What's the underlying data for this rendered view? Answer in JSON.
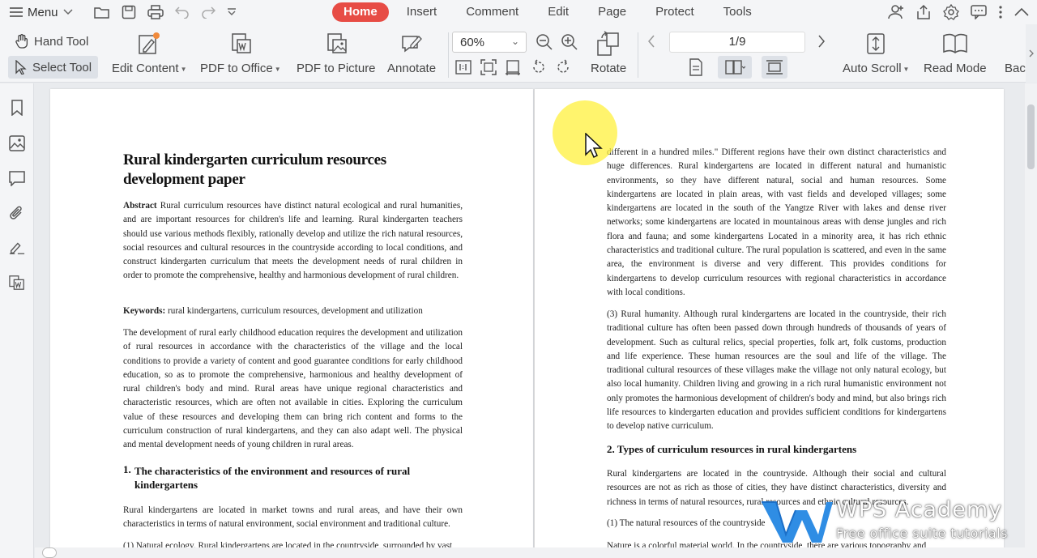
{
  "menubar": {
    "menu_label": "Menu",
    "tabs": [
      "Home",
      "Insert",
      "Comment",
      "Edit",
      "Page",
      "Protect",
      "Tools"
    ],
    "active_tab": "Home",
    "accent_color": "#e74c45"
  },
  "ribbon": {
    "hand_tool": "Hand Tool",
    "select_tool": "Select Tool",
    "edit_content": "Edit Content",
    "pdf_to_office": "PDF to Office",
    "pdf_to_picture": "PDF to Picture",
    "annotate": "Annotate",
    "zoom": "60%",
    "rotate": "Rotate",
    "page_indicator": "1/9",
    "auto_scroll": "Auto Scroll",
    "read_mode": "Read Mode",
    "back": "Bac"
  },
  "document": {
    "title_line1": "Rural kindergarten curriculum resources",
    "title_line2": "development paper",
    "abstract_label": "Abstract",
    "abstract_text": " Rural curriculum resources have distinct natural ecological and rural humanities, and are important resources for children's life and learning. Rural kindergarten teachers should use various methods flexibly, rationally develop and utilize the rich natural resources, social resources and cultural resources in the countryside according to local conditions, and construct kindergarten curriculum that meets the development needs of rural children in order to promote the comprehensive, healthy and harmonious development of rural children.",
    "keywords_label": "Keywords:",
    "keywords_text": " rural kindergartens, curriculum resources, development and utilization",
    "intro_text": "The development of rural early childhood education requires the development and utilization of rural resources in accordance with the characteristics of the village and the local conditions to provide a variety of content and good guarantee conditions for early childhood education, so as to promote the comprehensive, harmonious and healthy development of rural children's body and mind. Rural areas have unique regional characteristics and characteristic resources, which are often not available in cities. Exploring the curriculum value of these resources and developing them can bring rich content and forms to the curriculum construction of rural kindergartens, and they can also adapt well. The physical and mental development needs of young children in rural areas.",
    "section1_num": "1.",
    "section1_title_line1": "The characteristics of the environment and resources of rural",
    "section1_title_line2": "kindergartens",
    "section1_text": "Rural kindergartens are located in market towns and rural areas, and have their own characteristics in terms of natural environment, social environment and traditional culture.",
    "section1_sub": "(1) Natural ecology. Rural kindergartens are located in the countryside, surrounded by vast",
    "right_p1": "different in a hundred miles.\" Different regions have their own distinct characteristics and huge differences. Rural kindergartens are located in different natural and humanistic environments, so they have different natural, social and human resources. Some kindergartens are located in plain areas, with vast fields and developed villages; some kindergartens are located in the south of the Yangtze River with lakes and dense river networks; some kindergartens are located in mountainous areas with dense jungles and rich flora and fauna; and some kindergartens Located in a minority area, it has rich ethnic characteristics and traditional culture. The rural population is scattered, and even in the same area, the environment is diverse and very different. This provides conditions for kindergartens to develop curriculum resources with regional characteristics in accordance with local conditions.",
    "right_p2": "(3) Rural humanity. Although rural kindergartens are located in the countryside, their rich traditional culture has often been passed down through hundreds of thousands of years of development. Such as cultural relics, special properties, folk art, folk customs, production and life experience. These human resources are the soul and life of the village. The traditional cultural resources of these villages make the village not only natural ecology, but also local humanity. Children living and growing in a rich rural humanistic environment not only promotes the harmonious development of children's body and mind, but also brings rich life resources to kindergarten education and provides sufficient conditions for kindergartens to develop native curriculum.",
    "section2_title": "2. Types of curriculum resources in rural kindergartens",
    "right_p3": "Rural kindergartens are located in the countryside. Although their social and cultural resources are not as rich as those of cities, they have distinct characteristics, diversity and richness in terms of natural resources, rural resources and ethnic cultural resources.",
    "right_p4": "(1) The natural resources of the countryside",
    "right_p5": "Nature is a colorful material world. In the countryside, there are various topography and"
  },
  "watermark": {
    "title": "WPS Academy",
    "subtitle": "Free office suite tutorials"
  }
}
